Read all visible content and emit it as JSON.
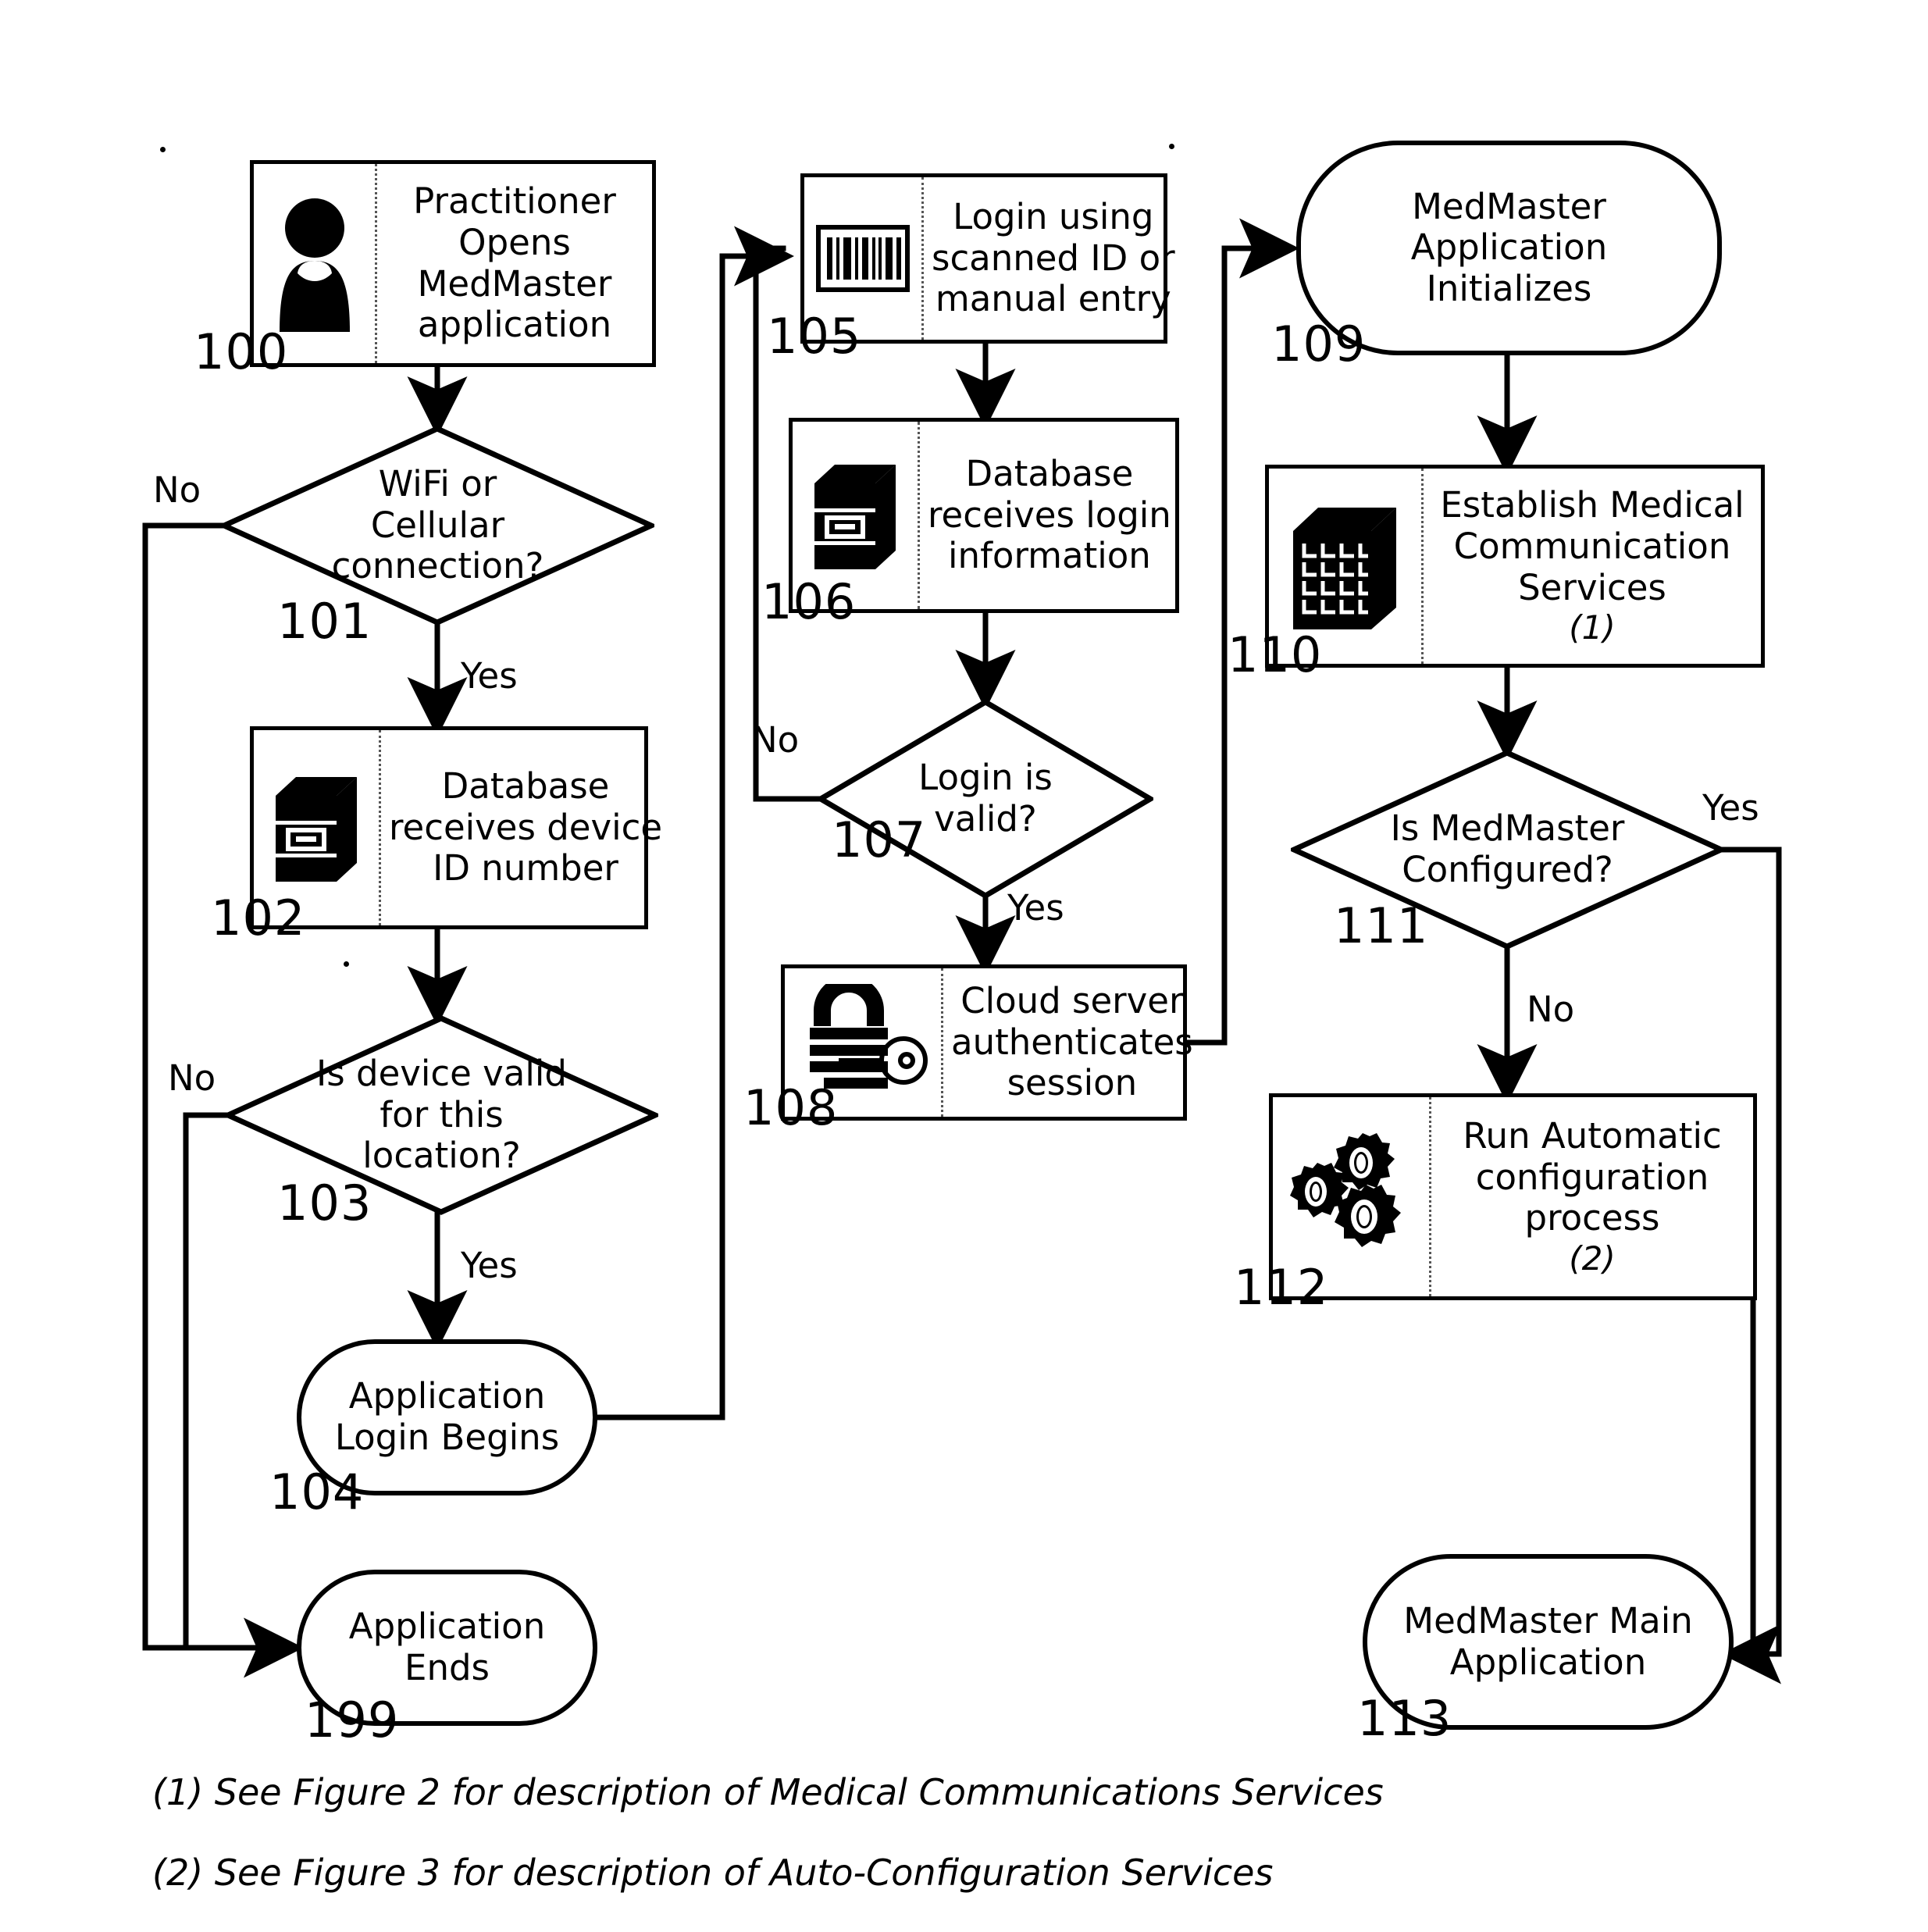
{
  "figure": {
    "title": "MedMaster application startup and login flowchart",
    "background": "#ffffff",
    "ink": "#000000"
  },
  "nodes": [
    {
      "id": "n100",
      "ref": "100",
      "shape": "process",
      "icon": "person-icon",
      "lines": [
        "Practitioner",
        "Opens",
        "MedMaster",
        "application"
      ]
    },
    {
      "id": "n101",
      "ref": "101",
      "shape": "decision",
      "lines": [
        "WiFi or",
        "Cellular",
        "connection?"
      ]
    },
    {
      "id": "n102",
      "ref": "102",
      "shape": "process",
      "icon": "database-icon",
      "lines": [
        "Database",
        "receives device",
        "ID number"
      ]
    },
    {
      "id": "n103",
      "ref": "103",
      "shape": "decision",
      "lines": [
        "Is device valid",
        "for this",
        "location?"
      ]
    },
    {
      "id": "n104",
      "ref": "104",
      "shape": "terminator",
      "lines": [
        "Application",
        "Login Begins"
      ]
    },
    {
      "id": "n199",
      "ref": "199",
      "shape": "terminator",
      "lines": [
        "Application",
        "Ends"
      ]
    },
    {
      "id": "n105",
      "ref": "105",
      "shape": "process",
      "icon": "barcode-icon",
      "lines": [
        "Login using",
        "scanned ID or",
        "manual entry"
      ]
    },
    {
      "id": "n106",
      "ref": "106",
      "shape": "process",
      "icon": "database-icon",
      "lines": [
        "Database",
        "receives login",
        "information"
      ]
    },
    {
      "id": "n107",
      "ref": "107",
      "shape": "decision",
      "lines": [
        "Login is",
        "valid?"
      ]
    },
    {
      "id": "n108",
      "ref": "108",
      "shape": "process",
      "icon": "padlock-key-icon",
      "lines": [
        "Cloud server",
        "authenticates",
        "session"
      ]
    },
    {
      "id": "n109",
      "ref": "109",
      "shape": "terminator",
      "lines": [
        "MedMaster",
        "Application",
        "Initializes"
      ]
    },
    {
      "id": "n110",
      "ref": "110",
      "shape": "process",
      "icon": "server-rack-icon",
      "lines": [
        "Establish Medical",
        "Communication",
        "Services",
        "(1)"
      ],
      "italic_last": true
    },
    {
      "id": "n111",
      "ref": "111",
      "shape": "decision",
      "lines": [
        "Is MedMaster",
        "Configured?"
      ]
    },
    {
      "id": "n112",
      "ref": "112",
      "shape": "process",
      "icon": "gears-icon",
      "lines": [
        "Run Automatic",
        "configuration",
        "process",
        "(2)"
      ],
      "italic_last": true
    },
    {
      "id": "n113",
      "ref": "113",
      "shape": "terminator",
      "lines": [
        "MedMaster Main",
        "Application"
      ]
    }
  ],
  "edge_labels": [
    {
      "id": "e101no",
      "text": "No"
    },
    {
      "id": "e101yes",
      "text": "Yes"
    },
    {
      "id": "e103no",
      "text": "No"
    },
    {
      "id": "e103yes",
      "text": "Yes"
    },
    {
      "id": "e107no",
      "text": "No"
    },
    {
      "id": "e107yes",
      "text": "Yes"
    },
    {
      "id": "e111yes",
      "text": "Yes"
    },
    {
      "id": "e111no",
      "text": "No"
    }
  ],
  "footnotes": [
    "(1) See Figure 2 for description of Medical Communications Services",
    "(2) See Figure 3 for description of Auto-Configuration Services"
  ]
}
